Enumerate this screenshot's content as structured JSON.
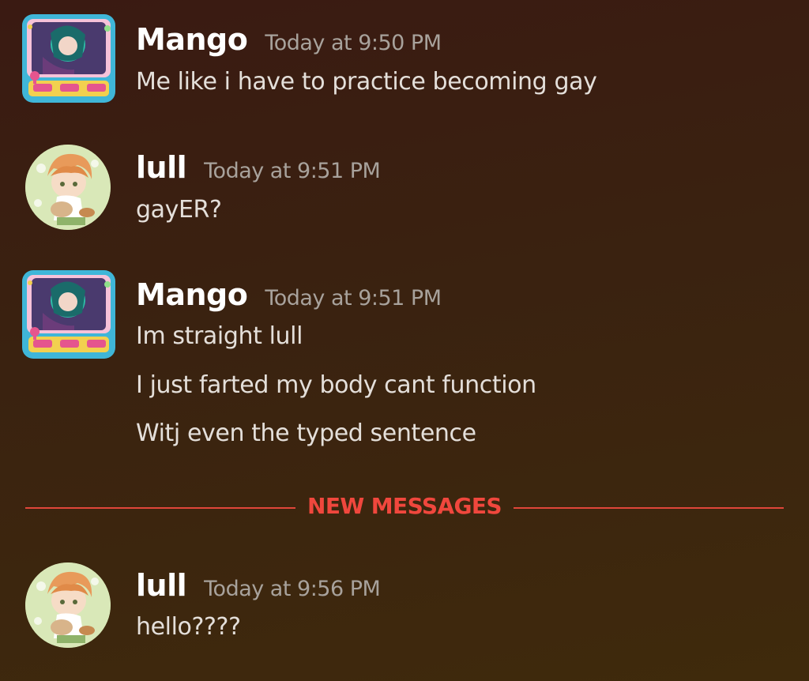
{
  "messages": [
    {
      "author": "Mango",
      "timestamp": "Today at 9:50 PM",
      "lines": [
        "Me like i have to practice becoming gay"
      ]
    },
    {
      "author": "lull",
      "timestamp": "Today at 9:51 PM",
      "lines": [
        "gayER?"
      ]
    },
    {
      "author": "Mango",
      "timestamp": "Today at 9:51 PM",
      "lines": [
        "Im straight lull",
        "I just farted my body cant function",
        "Witj even the typed sentence"
      ]
    },
    {
      "author": "lull",
      "timestamp": "Today at 9:56 PM",
      "lines": [
        "hello????"
      ]
    }
  ],
  "divider": {
    "label": "NEW MESSAGES"
  },
  "colors": {
    "divider": "#e0463a",
    "username": "#ffffff",
    "timestamp": "#a8a29c",
    "message_text": "#e4dfda"
  },
  "icons": {
    "mango_avatar": "arcade-machine-avatar",
    "lull_avatar": "anime-character-avatar"
  }
}
